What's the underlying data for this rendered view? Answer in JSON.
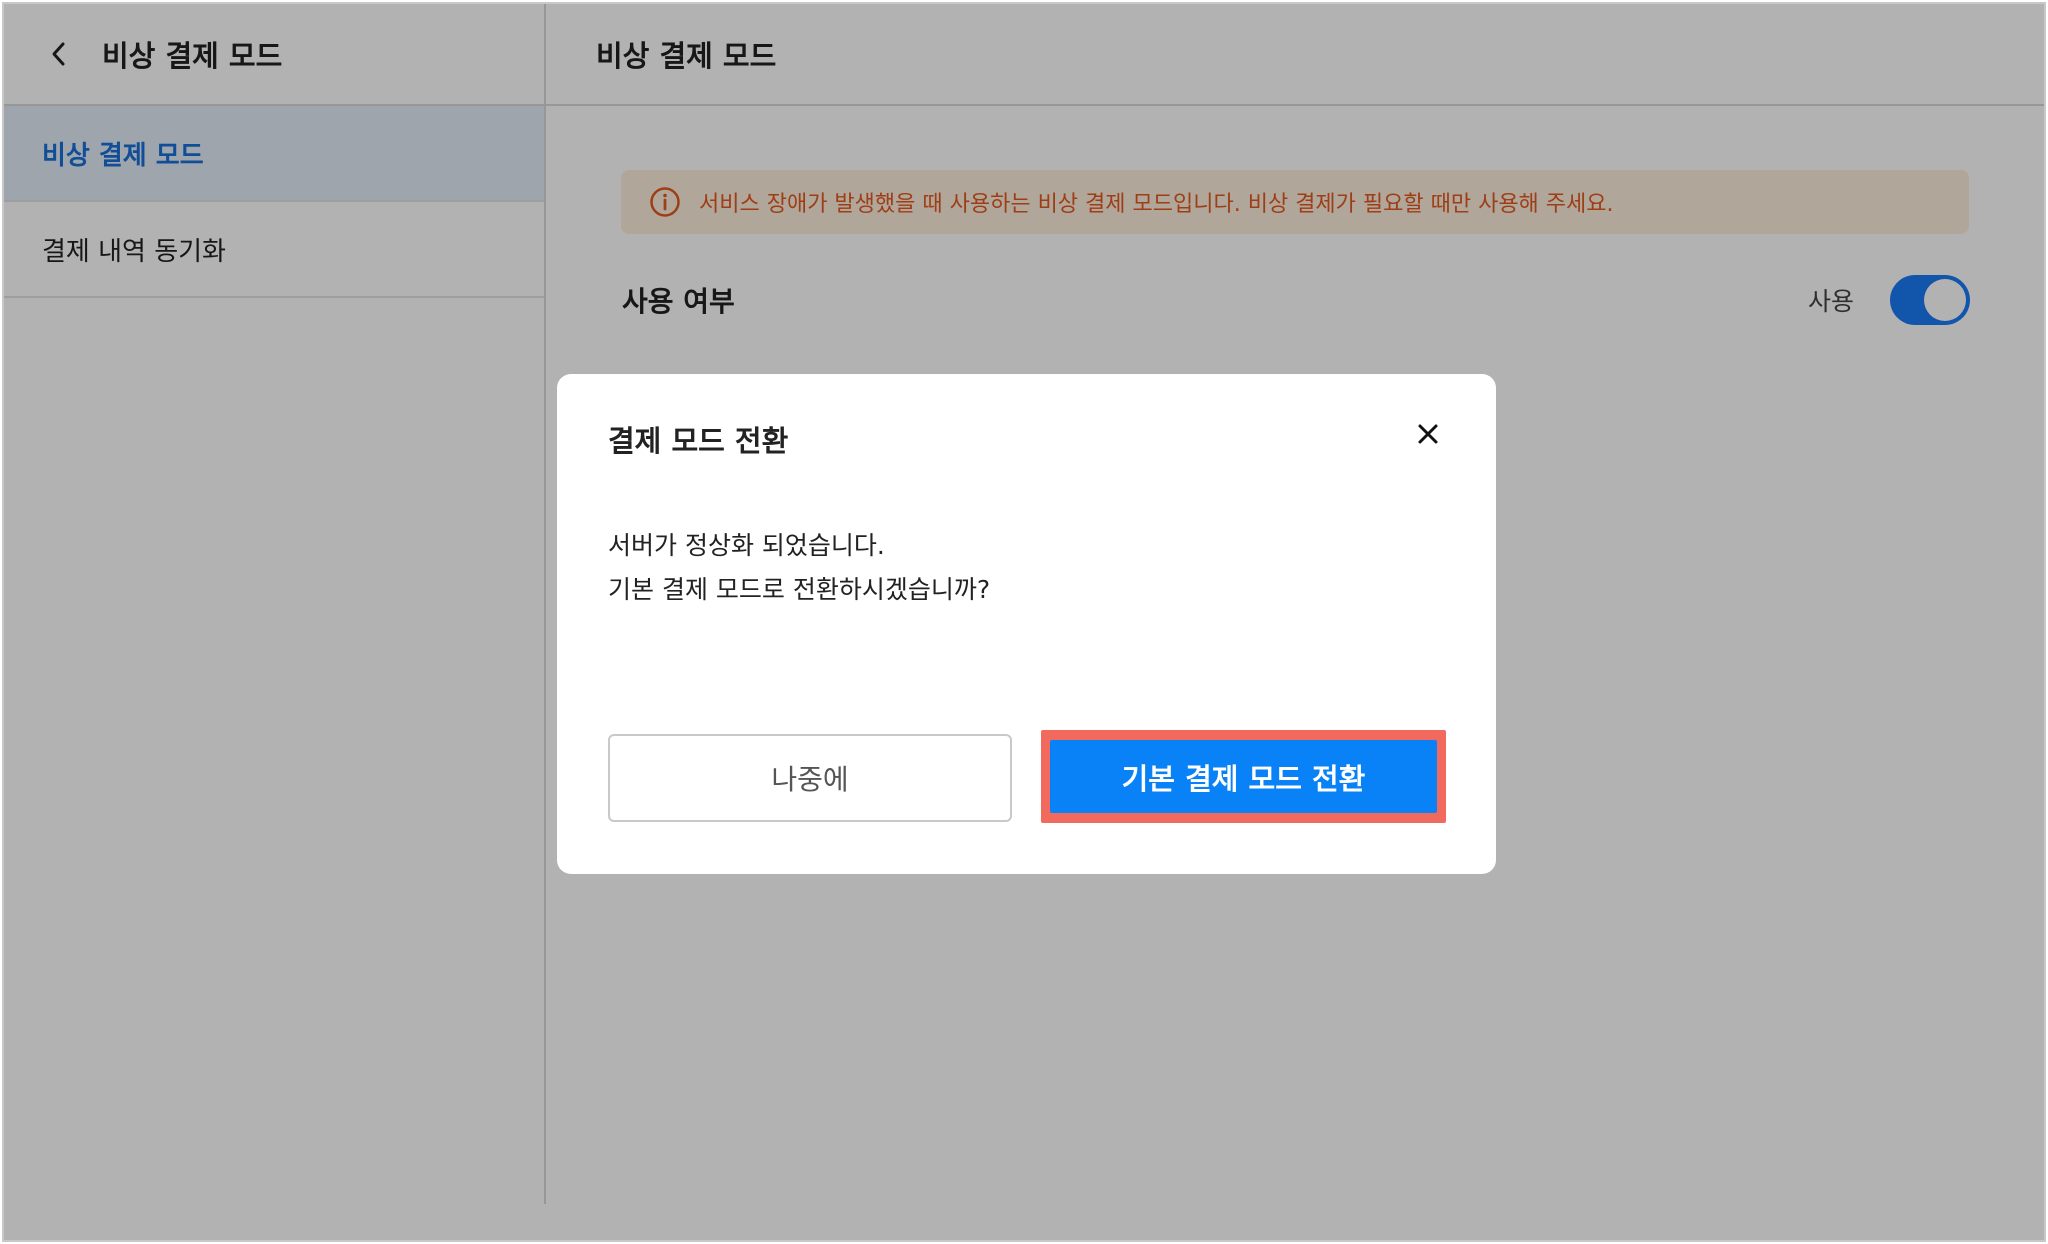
{
  "sidebar": {
    "title": "비상 결제 모드",
    "items": [
      {
        "label": "비상 결제 모드",
        "active": true
      },
      {
        "label": "결제 내역 동기화",
        "active": false
      }
    ]
  },
  "main": {
    "title": "비상 결제 모드",
    "notice": "서비스 장애가 발생했을 때 사용하는 비상 결제 모드입니다. 비상 결제가 필요할 때만 사용해 주세요.",
    "usage_label": "사용 여부",
    "usage_state": "사용",
    "toggle_on": true
  },
  "modal": {
    "title": "결제 모드 전환",
    "message_line1": "서버가 정상화 되었습니다.",
    "message_line2": "기본 결제 모드로 전환하시겠습니까?",
    "cancel_label": "나중에",
    "confirm_label": "기본 결제 모드 전환"
  },
  "colors": {
    "accent": "#0a82f7",
    "notice_text": "#e45a20",
    "highlight_border": "#f26a5e",
    "active_item": "#1a6fd8"
  },
  "icons": {
    "back": "chevron-left-icon",
    "notice": "info-circle-icon",
    "close": "close-icon"
  }
}
